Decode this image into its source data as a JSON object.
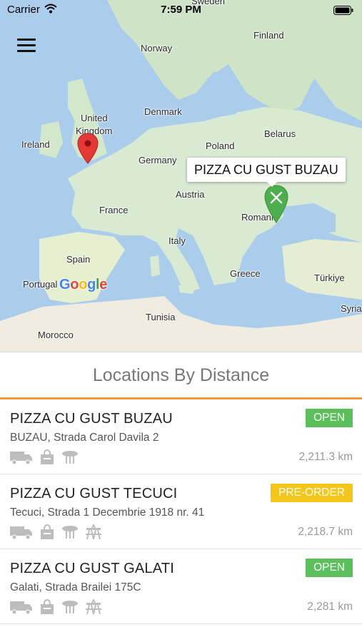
{
  "status_bar": {
    "carrier": "Carrier",
    "time": "7:59 PM"
  },
  "map": {
    "labels": [
      {
        "text": "Sweden"
      },
      {
        "text": "Finland"
      },
      {
        "text": "Norway"
      },
      {
        "text": "United"
      },
      {
        "text": "Kingdom"
      },
      {
        "text": "Denmark"
      },
      {
        "text": "Ireland"
      },
      {
        "text": "Belarus"
      },
      {
        "text": "Poland"
      },
      {
        "text": "Germany"
      },
      {
        "text": "Austria"
      },
      {
        "text": "France"
      },
      {
        "text": "Romania"
      },
      {
        "text": "Italy"
      },
      {
        "text": "Spain"
      },
      {
        "text": "Greece"
      },
      {
        "text": "Türkiye"
      },
      {
        "text": "Portugal"
      },
      {
        "text": "Tunisia"
      },
      {
        "text": "Syria"
      },
      {
        "text": "Morocco"
      }
    ],
    "callout": "PIZZA CU GUST BUZAU",
    "attribution": "Google",
    "water_color": "#a9cdeb",
    "land_color": "#d9ead2"
  },
  "panel": {
    "title": "Locations By Distance",
    "accent_color": "#f39a3d"
  },
  "locations": [
    {
      "name": "PIZZA CU GUST BUZAU",
      "address": "BUZAU, Strada Carol Davila 2",
      "status": "OPEN",
      "status_color": "#5bbf5b",
      "distance": "2,211.3 km",
      "icons": [
        "delivery-truck-icon",
        "takeaway-bag-icon",
        "dine-in-table-icon"
      ]
    },
    {
      "name": "PIZZA CU GUST TECUCI",
      "address": "Tecuci, Strada 1 Decembrie 1918 nr. 41",
      "status": "PRE-ORDER",
      "status_color": "#f5c518",
      "distance": "2,218.7 km",
      "icons": [
        "delivery-truck-icon",
        "takeaway-bag-icon",
        "dine-in-table-icon",
        "outdoor-seating-icon"
      ]
    },
    {
      "name": "PIZZA CU GUST GALATI",
      "address": "Galati, Strada Brailei 175C",
      "status": "OPEN",
      "status_color": "#5bbf5b",
      "distance": "2,281 km",
      "icons": [
        "delivery-truck-icon",
        "takeaway-bag-icon",
        "dine-in-table-icon",
        "outdoor-seating-icon"
      ]
    }
  ]
}
